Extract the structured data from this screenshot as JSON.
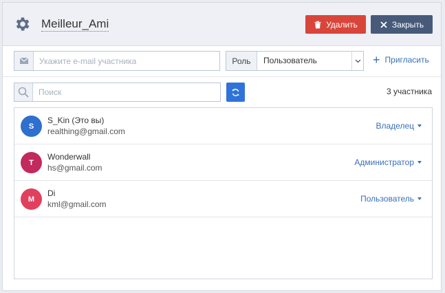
{
  "header": {
    "title": "Meilleur_Ami",
    "delete_label": "Удалить",
    "close_label": "Закрыть"
  },
  "invite": {
    "email_placeholder": "Укажите e-mail участника",
    "role_label": "Роль",
    "role_value": "Пользователь",
    "invite_label": "Пригласить"
  },
  "search": {
    "placeholder": "Поиск",
    "count_text": "3 участника"
  },
  "members": [
    {
      "initial": "S",
      "name": "S_Kin (Это вы)",
      "email": "realthing@gmail.com",
      "role": "Владелец",
      "avatar_color": "#2f6fcf"
    },
    {
      "initial": "T",
      "name": "Wonderwall",
      "email": "hs@gmail.com",
      "role": "Администратор",
      "avatar_color": "#c2295c"
    },
    {
      "initial": "M",
      "name": "Di",
      "email": "kml@gmail.com",
      "role": "Пользователь",
      "avatar_color": "#e0405e"
    }
  ],
  "colors": {
    "accent": "#3a6fb8",
    "delete": "#d9453a",
    "close": "#475a7a",
    "refresh": "#2f73d8"
  }
}
